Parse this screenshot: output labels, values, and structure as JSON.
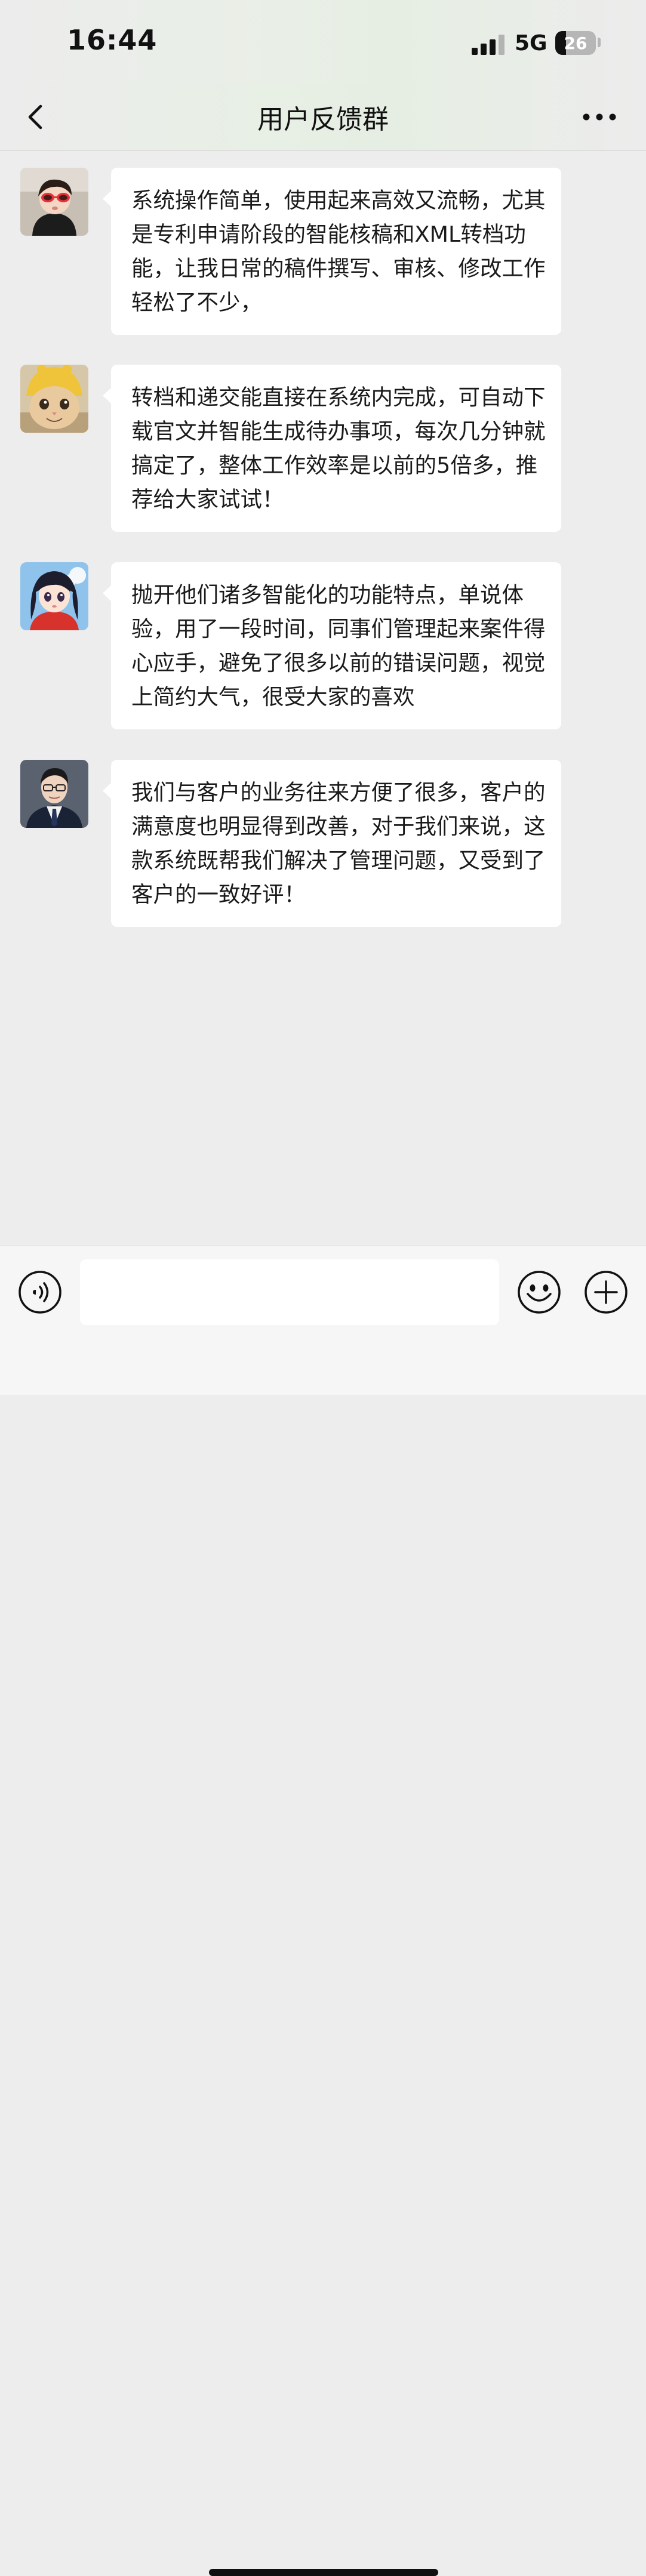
{
  "status_bar": {
    "time": "16:44",
    "network": "5G",
    "battery": "26",
    "battery_level": 0.26
  },
  "header": {
    "title": "用户反馈群",
    "back_icon": "chevron-left-icon",
    "more_icon": "more-dots-icon"
  },
  "messages": [
    {
      "avatar": "avatar-child-sunglasses",
      "text": "系统操作简单，使用起来高效又流畅，尤其是专利申请阶段的智能核稿和XML转档功能，让我日常的稿件撰写、审核、修改工作轻松了不少，"
    },
    {
      "avatar": "avatar-cat-yellow-hat",
      "text": "转档和递交能直接在系统内完成，可自动下载官文并智能生成待办事项，每次几分钟就搞定了，整体工作效率是以前的5倍多，推荐给大家试试！"
    },
    {
      "avatar": "avatar-anime-girl",
      "text": "抛开他们诸多智能化的功能特点，单说体验，用了一段时间，同事们管理起来案件得心应手，避免了很多以前的错误问题，视觉上简约大气，很受大家的喜欢"
    },
    {
      "avatar": "avatar-man-suit",
      "text": "我们与客户的业务往来方便了很多，客户的满意度也明显得到改善，对于我们来说，这款系统既帮我们解决了管理问题，又受到了客户的一致好评！"
    }
  ],
  "input_bar": {
    "placeholder": "",
    "voice_icon": "voice-icon",
    "emoji_icon": "emoji-icon",
    "plus_icon": "plus-icon"
  },
  "colors": {
    "background": "#ededed",
    "bubble": "#ffffff",
    "accent": "#111111"
  }
}
